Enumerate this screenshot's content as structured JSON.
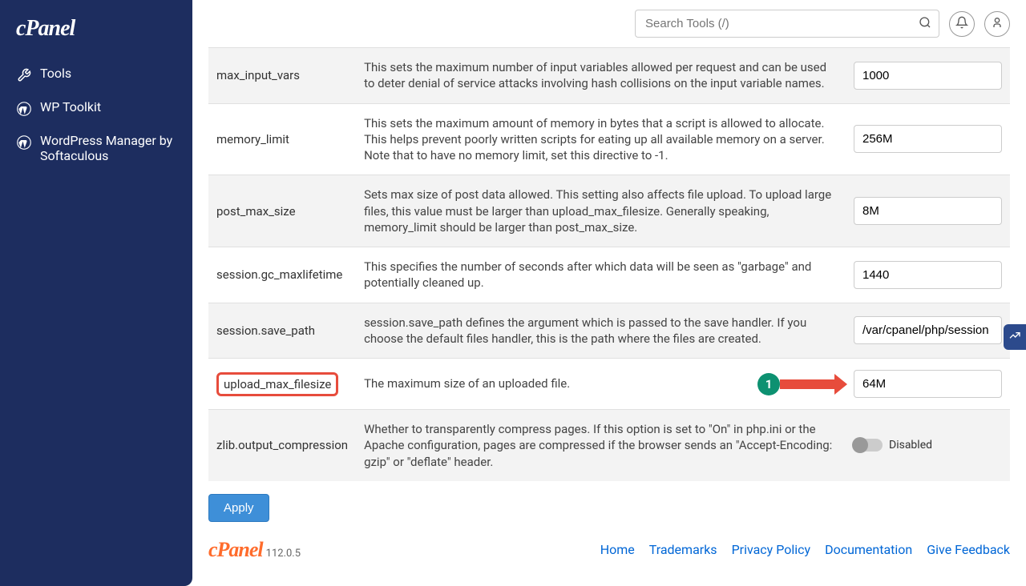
{
  "logo": "cPanel",
  "sidebar": {
    "items": [
      {
        "label": "Tools",
        "icon": "tools"
      },
      {
        "label": "WP Toolkit",
        "icon": "wp"
      },
      {
        "label": "WordPress Manager by Softaculous",
        "icon": "wp"
      }
    ]
  },
  "topbar": {
    "search_placeholder": "Search Tools (/)"
  },
  "settings": [
    {
      "name": "max_input_vars",
      "desc": "This sets the maximum number of input variables allowed per request and can be used to deter denial of service attacks involving hash collisions on the input variable names.",
      "value": "1000"
    },
    {
      "name": "memory_limit",
      "desc": "This sets the maximum amount of memory in bytes that a script is allowed to allocate. This helps prevent poorly written scripts for eating up all available memory on a server. Note that to have no memory limit, set this directive to -1.",
      "value": "256M"
    },
    {
      "name": "post_max_size",
      "desc": "Sets max size of post data allowed. This setting also affects file upload. To upload large files, this value must be larger than upload_max_filesize. Generally speaking, memory_limit should be larger than post_max_size.",
      "value": "8M"
    },
    {
      "name": "session.gc_maxlifetime",
      "desc": "This specifies the number of seconds after which data will be seen as \"garbage\" and potentially cleaned up.",
      "value": "1440"
    },
    {
      "name": "session.save_path",
      "desc": "session.save_path defines the argument which is passed to the save handler. If you choose the default files handler, this is the path where the files are created.",
      "value": "/var/cpanel/php/session"
    },
    {
      "name": "upload_max_filesize",
      "desc": "The maximum size of an uploaded file.",
      "value": "64M",
      "highlighted": true
    },
    {
      "name": "zlib.output_compression",
      "desc": "Whether to transparently compress pages. If this option is set to \"On\" in php.ini or the Apache configuration, pages are compressed if the browser sends an \"Accept-Encoding: gzip\" or \"deflate\" header.",
      "toggle": true,
      "toggle_label": "Disabled"
    }
  ],
  "apply_label": "Apply",
  "annotation": {
    "badge": "1"
  },
  "footer": {
    "logo": "cPanel",
    "version": "112.0.5",
    "links": [
      {
        "label": "Home"
      },
      {
        "label": "Trademarks"
      },
      {
        "label": "Privacy Policy"
      },
      {
        "label": "Documentation"
      },
      {
        "label": "Give Feedback"
      }
    ]
  }
}
